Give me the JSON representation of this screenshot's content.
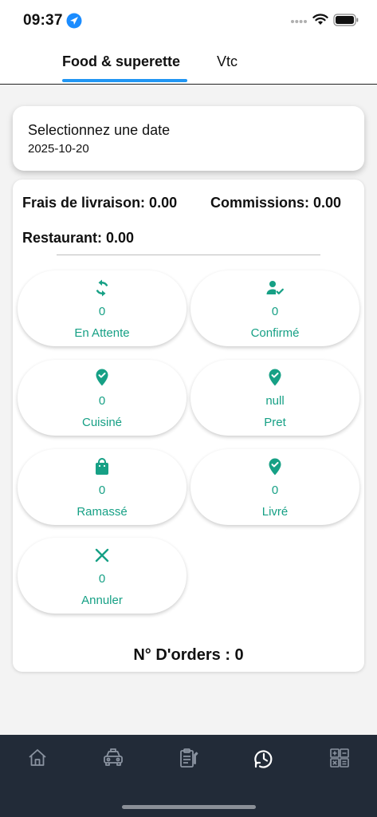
{
  "status_bar": {
    "time": "09:37"
  },
  "tabs": [
    {
      "label": "Food & superette",
      "active": true
    },
    {
      "label": "Vtc",
      "active": false
    }
  ],
  "date_picker": {
    "label": "Selectionnez une date",
    "value": "2025-10-20"
  },
  "summary": {
    "frais": "Frais de livraison: 0.00",
    "commissions": "Commissions: 0.00",
    "restaurant": "Restaurant: 0.00"
  },
  "statuses": [
    {
      "icon": "refresh-icon",
      "count": "0",
      "label": "En Attente"
    },
    {
      "icon": "user-check-icon",
      "count": "0",
      "label": "Confirmé"
    },
    {
      "icon": "location-check-icon",
      "count": "0",
      "label": "Cuisiné"
    },
    {
      "icon": "location-check-icon",
      "count": "null",
      "label": "Pret"
    },
    {
      "icon": "shopping-bag-icon",
      "count": "0",
      "label": "Ramassé"
    },
    {
      "icon": "location-check-icon",
      "count": "0",
      "label": "Livré"
    },
    {
      "icon": "close-icon",
      "count": "0",
      "label": "Annuler"
    }
  ],
  "orders_total": "N° D'orders : 0",
  "bottom_nav": [
    {
      "icon": "home-icon"
    },
    {
      "icon": "taxi-icon"
    },
    {
      "icon": "clipboard-icon"
    },
    {
      "icon": "history-clock-icon",
      "active": true
    },
    {
      "icon": "calculator-icon"
    }
  ],
  "colors": {
    "accent": "#16a085",
    "tab_indicator": "#2196f3",
    "nav_bg": "#222b38"
  }
}
